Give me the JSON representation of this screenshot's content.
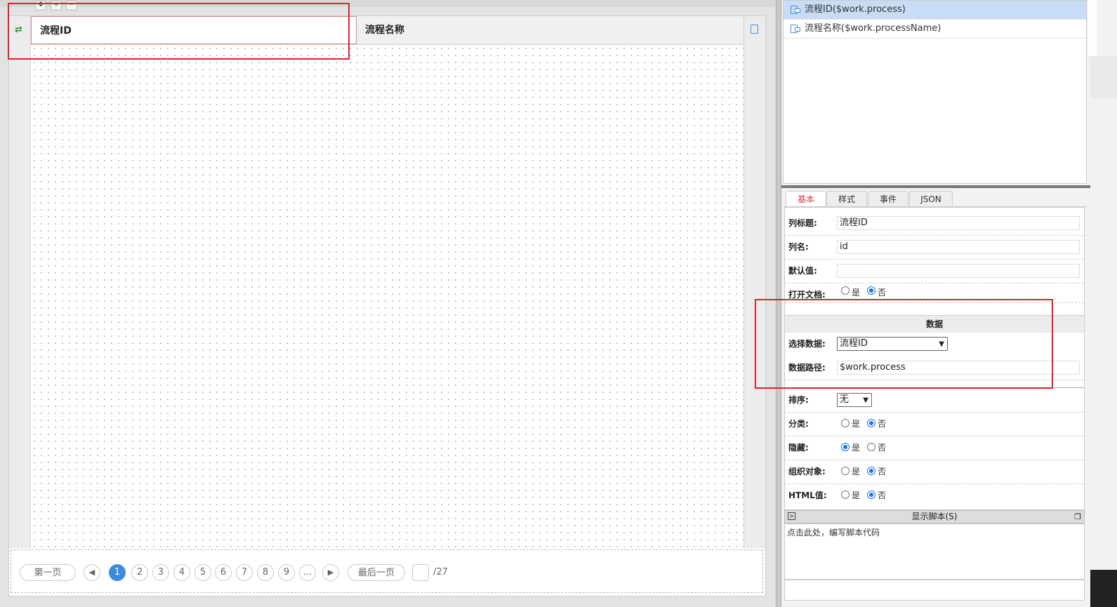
{
  "grid": {
    "columns": [
      "流程ID",
      "流程名称"
    ]
  },
  "pager": {
    "first": "第一页",
    "last": "最后一页",
    "pages": [
      "1",
      "2",
      "3",
      "4",
      "5",
      "6",
      "7",
      "8",
      "9",
      "..."
    ],
    "current_page": "1",
    "total": "/27",
    "colors": {
      "active": "#3b8ddb"
    }
  },
  "field_list": [
    {
      "label": "流程ID($work.process)",
      "selected": true
    },
    {
      "label": "流程名称($work.processName)",
      "selected": false
    }
  ],
  "tabs": [
    "基本",
    "样式",
    "事件",
    "JSON"
  ],
  "props": {
    "title_label": "列标题:",
    "title_value": "流程ID",
    "name_label": "列名:",
    "name_value": "id",
    "default_label": "默认值:",
    "default_value": "",
    "open_doc_label": "打开文档:",
    "section_data": "数据",
    "select_data_label": "选择数据:",
    "select_data_value": "流程ID",
    "data_path_label": "数据路径:",
    "data_path_value": "$work.process",
    "sort_label": "排序:",
    "sort_value": "无",
    "category_label": "分类:",
    "hidden_label": "隐藏:",
    "org_label": "组织对象:",
    "html_label": "HTML值:",
    "yes": "是",
    "no": "否"
  },
  "script": {
    "bar_label": "显示脚本(S)",
    "placeholder": "点击此处，编写脚本代码"
  },
  "accent_color": "#e5202a"
}
